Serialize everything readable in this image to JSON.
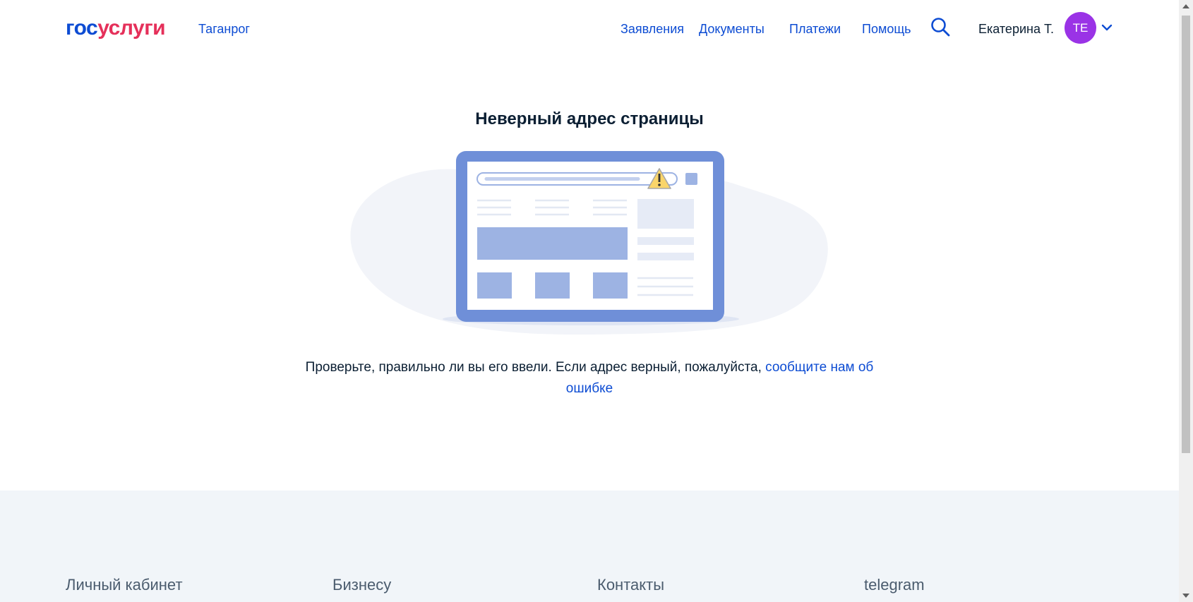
{
  "header": {
    "logo": {
      "part1": "гос",
      "part2": "услуги"
    },
    "city": "Таганрог",
    "nav": [
      "Заявления",
      "Документы",
      "Платежи",
      "Помощь"
    ],
    "user_name": "Екатерина Т.",
    "avatar_initials": "ТЕ"
  },
  "main": {
    "title": "Неверный адрес страницы",
    "message": "Проверьте, правильно ли вы его ввели. Если адрес верный, пожалуйста, ",
    "message_link": "сообщите нам об ошибке"
  },
  "footer": {
    "columns": [
      "Личный кабинет",
      "Бизнесу",
      "Контакты",
      "telegram"
    ]
  },
  "colors": {
    "brand_blue": "#0d4cd3",
    "brand_red": "#e5305a",
    "avatar": "#9a33e6",
    "footer_bg": "#f1f5f9",
    "illustration_frame": "#6f8fd8",
    "illustration_block": "#9db3e3"
  }
}
